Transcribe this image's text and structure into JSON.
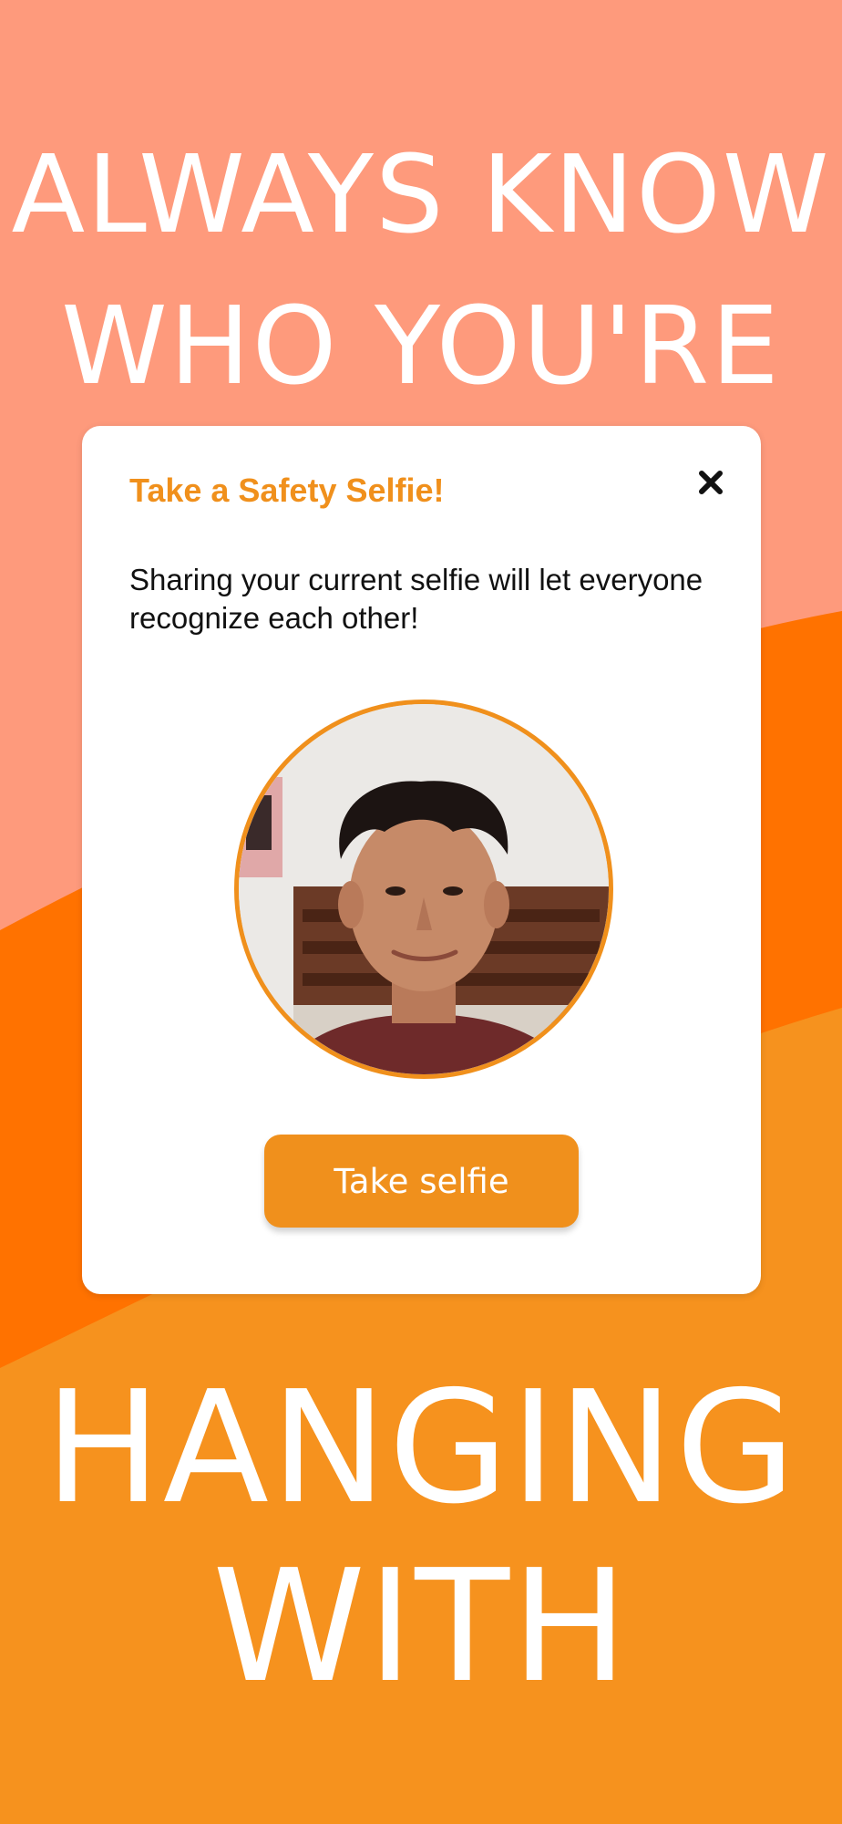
{
  "headline": {
    "top_line1": "ALWAYS KNOW",
    "top_line2": "WHO YOU'RE",
    "bottom_line1": "HANGING",
    "bottom_line2": "WITH"
  },
  "modal": {
    "title": "Take a Safety Selfie!",
    "description": "Sharing your current selfie will let everyone recognize each other!",
    "close_icon": "close-icon",
    "button_label": "Take selfie"
  },
  "colors": {
    "accent": "#f0901c",
    "bg_top": "#fe9a7c",
    "bg_middle": "#ff7200",
    "bg_bottom": "#f6921e",
    "text_primary": "#111111"
  }
}
